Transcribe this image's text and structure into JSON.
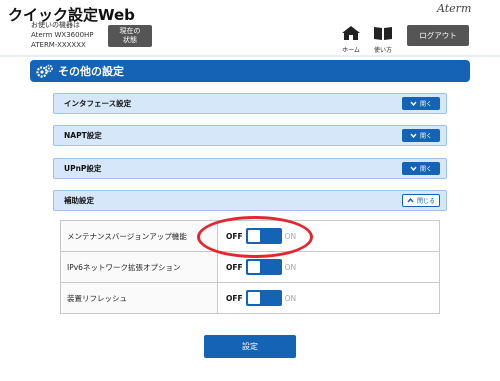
{
  "header": {
    "app_title": "クイック設定Web",
    "device_info": [
      "お使いの機器は",
      "Aterm WX3600HP",
      "ATERM-XXXXXX"
    ],
    "status_button": [
      "現在の",
      "状態"
    ],
    "logo": "Aterm",
    "nav": [
      {
        "label": "ホーム",
        "icon": "home-icon"
      },
      {
        "label": "使い方",
        "icon": "book-icon"
      }
    ],
    "logout_label": "ログアウト"
  },
  "section": {
    "title": "その他の設定",
    "icon": "gear-icon",
    "color": "#1463b4"
  },
  "accordions": [
    {
      "label": "インタフェース設定",
      "button": "開く",
      "state": "collapsed"
    },
    {
      "label": "NAPT設定",
      "button": "開く",
      "state": "collapsed"
    },
    {
      "label": "UPnP設定",
      "button": "開く",
      "state": "collapsed"
    },
    {
      "label": "補助設定",
      "button": "閉じる",
      "state": "expanded"
    }
  ],
  "settings": [
    {
      "label": "メンテナンスバージョンアップ機能",
      "off": "OFF",
      "on": "ON",
      "value": "OFF"
    },
    {
      "label": "IPv6ネットワーク拡張オプション",
      "off": "OFF",
      "on": "ON",
      "value": "OFF"
    },
    {
      "label": "装置リフレッシュ",
      "off": "OFF",
      "on": "ON",
      "value": "OFF"
    }
  ],
  "highlight_color": "#e3262f",
  "submit_label": "設定"
}
